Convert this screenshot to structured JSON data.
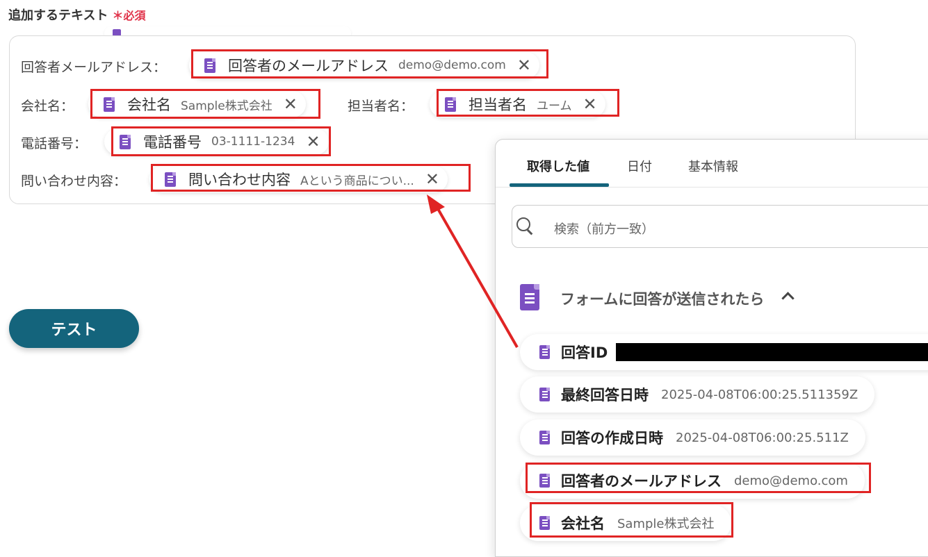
{
  "field": {
    "title": "追加するテキスト",
    "required_mark": "＊必須"
  },
  "form": {
    "rows": [
      {
        "label": "回答者メールアドレス：",
        "pill": {
          "name": "回答者のメールアドレス",
          "value": "demo@demo.com"
        }
      },
      {
        "label": "会社名：",
        "pill": {
          "name": "会社名",
          "value": "Sample株式会社"
        }
      },
      {
        "label": "担当者名：",
        "pill": {
          "name": "担当者名",
          "value": "ユーム"
        }
      },
      {
        "label": "電話番号：",
        "pill": {
          "name": "電話番号",
          "value": "03-1111-1234"
        }
      },
      {
        "label": "問い合わせ内容：",
        "pill": {
          "name": "問い合わせ内容",
          "value": "Aという商品につい..."
        }
      }
    ],
    "remove_glyph": "✕"
  },
  "test_button": {
    "label": "テスト"
  },
  "panel": {
    "tabs": [
      {
        "label": "取得した値"
      },
      {
        "label": "日付"
      },
      {
        "label": "基本情報"
      }
    ],
    "active_tab": "取得した値",
    "search": {
      "placeholder": "検索（前方一致）"
    },
    "group": {
      "title": "フォームに回答が送信されたら",
      "expanded": true
    },
    "items": [
      {
        "name": "回答ID",
        "value": "",
        "redacted": true
      },
      {
        "name": "最終回答日時",
        "value": "2025-04-08T06:00:25.511359Z"
      },
      {
        "name": "回答の作成日時",
        "value": "2025-04-08T06:00:25.511Z"
      },
      {
        "name": "回答者のメールアドレス",
        "value": "demo@demo.com"
      },
      {
        "name": "会社名",
        "value": "Sample株式会社"
      }
    ]
  },
  "colors": {
    "accent": "#14647c",
    "highlight": "#e02424",
    "forms_icon": "#7b4fc1",
    "required": "#e0334a"
  },
  "icons": [
    "google-forms-icon",
    "close-icon",
    "search-icon",
    "chevron-up-icon",
    "arrow"
  ]
}
